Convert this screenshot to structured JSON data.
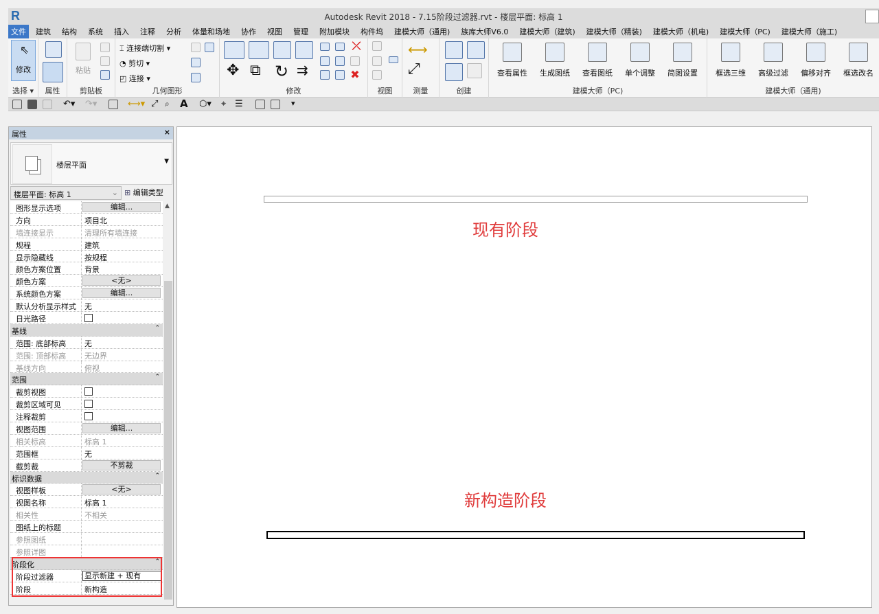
{
  "window": {
    "title": "Autodesk Revit 2018 -    7.15阶段过滤器.rvt - 楼层平面: 标高 1",
    "logo": "R"
  },
  "menu": {
    "file": "文件",
    "tabs": [
      "建筑",
      "结构",
      "系统",
      "插入",
      "注释",
      "分析",
      "体量和场地",
      "协作",
      "视图",
      "管理",
      "附加模块",
      "构件坞",
      "建模大师（通用)",
      "族库大师V6.0",
      "建模大师（建筑)",
      "建模大师（精装)",
      "建模大师（机电)",
      "建模大师（PC)",
      "建模大师（施工)"
    ]
  },
  "ribbon": {
    "select": {
      "label": "选择 ▾",
      "modify": "修改"
    },
    "properties": {
      "label": "属性"
    },
    "clipboard": {
      "label": "剪贴板",
      "paste": "粘贴"
    },
    "geometry": {
      "label": "几何图形",
      "items": [
        "连接端切割 ▾",
        "剪切 ▾",
        "连接 ▾"
      ]
    },
    "modify": {
      "label": "修改"
    },
    "view": {
      "label": "视图"
    },
    "measure": {
      "label": "测量"
    },
    "create": {
      "label": "创建"
    },
    "pc": {
      "label": "建模大师（PC)",
      "buttons": [
        "查看属性",
        "生成图纸",
        "查看图纸",
        "单个调整",
        "简图设置"
      ]
    },
    "general": {
      "label": "建模大师（通用)",
      "buttons": [
        "框选三维",
        "高级过滤",
        "偏移对齐",
        "框选改名"
      ]
    }
  },
  "properties": {
    "title": "属性",
    "close": "×",
    "type_name": "楼层平面",
    "instance": "楼层平面: 标高 1",
    "edit_type": "编辑类型",
    "rows": [
      {
        "label": "图形显示选项",
        "value": "编辑...",
        "kind": "button"
      },
      {
        "label": "方向",
        "value": "项目北"
      },
      {
        "label": "墙连接显示",
        "value": "清理所有墙连接",
        "disabled": true
      },
      {
        "label": "规程",
        "value": "建筑"
      },
      {
        "label": "显示隐藏线",
        "value": "按规程"
      },
      {
        "label": "颜色方案位置",
        "value": "背景"
      },
      {
        "label": "颜色方案",
        "value": "<无>",
        "kind": "button"
      },
      {
        "label": "系统颜色方案",
        "value": "编辑...",
        "kind": "button"
      },
      {
        "label": "默认分析显示样式",
        "value": "无"
      },
      {
        "label": "日光路径",
        "value": "",
        "kind": "checkbox",
        "checked": false
      },
      {
        "label": "基线",
        "kind": "header"
      },
      {
        "label": "范围: 底部标高",
        "value": "无"
      },
      {
        "label": "范围: 顶部标高",
        "value": "无边界",
        "disabled": true
      },
      {
        "label": "基线方向",
        "value": "俯视",
        "disabled": true
      },
      {
        "label": "范围",
        "kind": "header"
      },
      {
        "label": "裁剪视图",
        "value": "",
        "kind": "checkbox",
        "checked": false
      },
      {
        "label": "裁剪区域可见",
        "value": "",
        "kind": "checkbox",
        "checked": false
      },
      {
        "label": "注释裁剪",
        "value": "",
        "kind": "checkbox",
        "checked": false
      },
      {
        "label": "视图范围",
        "value": "编辑...",
        "kind": "button"
      },
      {
        "label": "相关标高",
        "value": "标高 1",
        "disabled": true
      },
      {
        "label": "范围框",
        "value": "无"
      },
      {
        "label": "截剪裁",
        "value": "不剪裁",
        "kind": "button"
      },
      {
        "label": "标识数据",
        "kind": "header"
      },
      {
        "label": "视图样板",
        "value": "<无>",
        "kind": "button"
      },
      {
        "label": "视图名称",
        "value": "标高 1"
      },
      {
        "label": "相关性",
        "value": "不相关",
        "disabled": true
      },
      {
        "label": "图纸上的标题",
        "value": ""
      },
      {
        "label": "参照图纸",
        "value": "",
        "disabled": true
      },
      {
        "label": "参照详图",
        "value": "",
        "disabled": true
      },
      {
        "label": "阶段化",
        "kind": "header"
      },
      {
        "label": "阶段过滤器",
        "value": "显示新建 + 现有",
        "kind": "box"
      },
      {
        "label": "阶段",
        "value": "新构造"
      }
    ]
  },
  "canvas": {
    "existing_label": "现有阶段",
    "new_label": "新构造阶段"
  },
  "colors": {
    "annotation": "#e03c3c",
    "highlight": "#e33333",
    "accent": "#3c78c8"
  }
}
